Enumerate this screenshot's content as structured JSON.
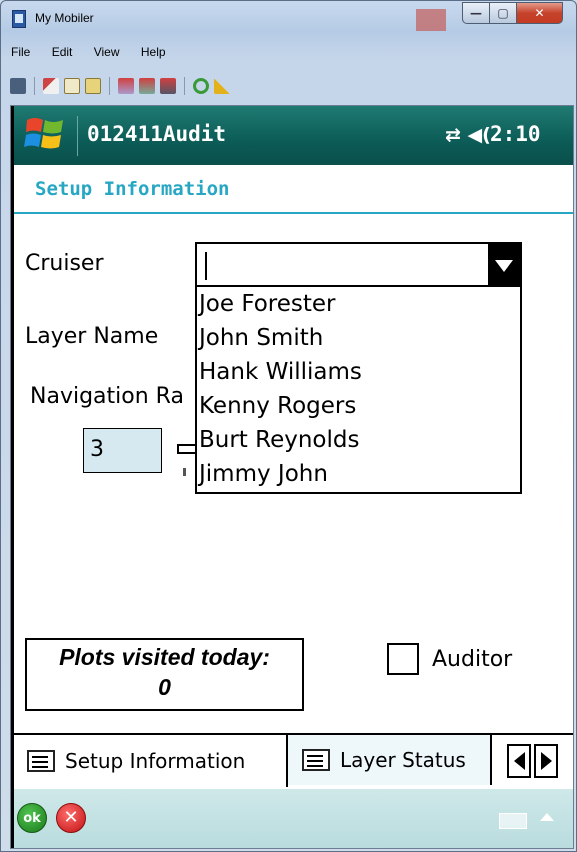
{
  "window": {
    "title": "My Mobiler",
    "controls": {
      "minimize_icon": "minimize-icon",
      "maximize_icon": "maximize-icon",
      "close_icon": "close-icon"
    }
  },
  "menu": [
    "File",
    "Edit",
    "View",
    "Help"
  ],
  "toolbar": {
    "icons": [
      "device-icon",
      "cut-icon",
      "copy-icon",
      "paste-icon",
      "sync-icon",
      "sync2-icon",
      "sync3-icon",
      "refresh-icon",
      "broom-icon"
    ]
  },
  "device": {
    "app_title": "012411Audit",
    "status_icons": "⇄ ◀(",
    "time": "2:10",
    "page_title": "Setup Information",
    "form": {
      "cruiser_label": "Cruiser",
      "cruiser_value": "",
      "cruiser_options": [
        "Joe Forester",
        "John Smith",
        "Hank Williams",
        "Kenny Rogers",
        "Burt Reynolds",
        "Jimmy John"
      ],
      "layer_label": "Layer Name",
      "nav_label": "Navigation Ra",
      "nav_value": "3",
      "plots_label": "Plots visited today:",
      "plots_value": "0",
      "auditor_label": "Auditor",
      "auditor_checked": false
    },
    "tabs": [
      {
        "label": "Setup Information",
        "icon": "form-icon"
      },
      {
        "label": "Layer Status",
        "icon": "form-icon"
      }
    ],
    "softkeys": {
      "ok": "ok",
      "cancel": "✕"
    }
  },
  "colors": {
    "accent": "#27a7c4",
    "topbar": "#0c5c57",
    "input_bg": "#d6e9f0"
  }
}
